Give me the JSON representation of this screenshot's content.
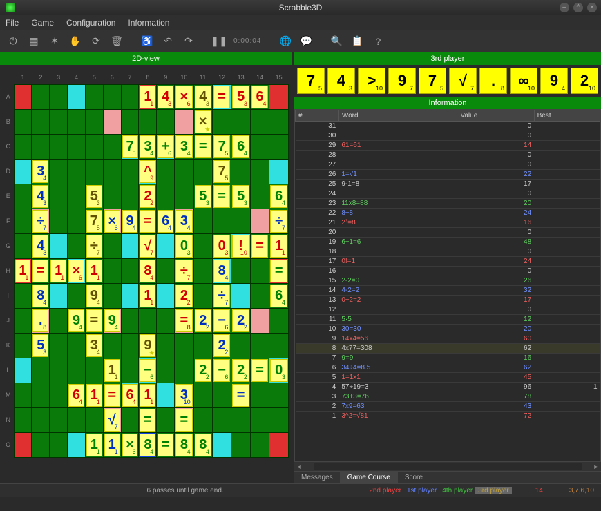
{
  "title": "Scrabble3D",
  "menu": [
    "File",
    "Game",
    "Configuration",
    "Information"
  ],
  "view_label": "2D-view",
  "player_label": "3rd player",
  "info_label": "Information",
  "cols": [
    "1",
    "2",
    "3",
    "4",
    "5",
    "6",
    "7",
    "8",
    "9",
    "10",
    "11",
    "12",
    "13",
    "14",
    "15"
  ],
  "rows": [
    "A",
    "B",
    "C",
    "D",
    "E",
    "F",
    "G",
    "H",
    "I",
    "J",
    "K",
    "L",
    "M",
    "N",
    "O"
  ],
  "counter": "0:00:04",
  "rack": [
    {
      "ch": "7",
      "sub": "5"
    },
    {
      "ch": "4",
      "sub": "3"
    },
    {
      "ch": ">",
      "sub": "10"
    },
    {
      "ch": "9",
      "sub": "7"
    },
    {
      "ch": "7",
      "sub": "5"
    },
    {
      "ch": "√",
      "sub": "7"
    },
    {
      "ch": ".",
      "sub": "8"
    },
    {
      "ch": "∞",
      "sub": "10"
    },
    {
      "ch": "9",
      "sub": "4"
    },
    {
      "ch": "2",
      "sub": "10"
    }
  ],
  "history_cols": [
    "#",
    "Word",
    "Value",
    "Best"
  ],
  "history": [
    {
      "n": "31",
      "w": "",
      "v": "0",
      "b": ""
    },
    {
      "n": "30",
      "w": "",
      "v": "0",
      "b": ""
    },
    {
      "n": "29",
      "w": "61=61",
      "v": "14",
      "b": "",
      "c": "red"
    },
    {
      "n": "28",
      "w": "",
      "v": "0",
      "b": ""
    },
    {
      "n": "27",
      "w": "",
      "v": "0",
      "b": ""
    },
    {
      "n": "26",
      "w": "1=√1",
      "v": "22",
      "b": "",
      "c": "blue"
    },
    {
      "n": "25",
      "w": "9-1=8",
      "v": "17",
      "b": ""
    },
    {
      "n": "24",
      "w": "",
      "v": "0",
      "b": ""
    },
    {
      "n": "23",
      "w": "11x8=88",
      "v": "20",
      "b": "",
      "c": "green"
    },
    {
      "n": "22",
      "w": "8÷8",
      "v": "24",
      "b": "",
      "c": "blue"
    },
    {
      "n": "21",
      "w": "2³=8",
      "v": "16",
      "b": "",
      "c": "red"
    },
    {
      "n": "20",
      "w": "",
      "v": "0",
      "b": ""
    },
    {
      "n": "19",
      "w": "6÷1=6",
      "v": "48",
      "b": "",
      "c": "green"
    },
    {
      "n": "18",
      "w": "",
      "v": "0",
      "b": ""
    },
    {
      "n": "17",
      "w": "0!=1",
      "v": "24",
      "b": "",
      "c": "red"
    },
    {
      "n": "16",
      "w": "",
      "v": "0",
      "b": ""
    },
    {
      "n": "15",
      "w": "2-2=0",
      "v": "26",
      "b": "",
      "c": "green"
    },
    {
      "n": "14",
      "w": "4-2=2",
      "v": "32",
      "b": "",
      "c": "blue"
    },
    {
      "n": "13",
      "w": "0÷2=2",
      "v": "17",
      "b": "",
      "c": "red"
    },
    {
      "n": "12",
      "w": "",
      "v": "0",
      "b": ""
    },
    {
      "n": "11",
      "w": "5·5",
      "v": "12",
      "b": "",
      "c": "green"
    },
    {
      "n": "10",
      "w": "30=30",
      "v": "20",
      "b": "",
      "c": "blue"
    },
    {
      "n": "9",
      "w": "14x4=56",
      "v": "60",
      "b": "",
      "c": "red"
    },
    {
      "n": "8",
      "w": "4x77=308",
      "v": "62",
      "b": "",
      "hl": true
    },
    {
      "n": "7",
      "w": "9=9",
      "v": "16",
      "b": "",
      "c": "green"
    },
    {
      "n": "6",
      "w": "34÷4=8.5",
      "v": "62",
      "b": "",
      "c": "blue"
    },
    {
      "n": "5",
      "w": "1=1x1",
      "v": "45",
      "b": "",
      "c": "red"
    },
    {
      "n": "4",
      "w": "57÷19=3",
      "v": "96",
      "b": "1"
    },
    {
      "n": "3",
      "w": "73+3=76",
      "v": "78",
      "b": "",
      "c": "green"
    },
    {
      "n": "2",
      "w": "7x9=63",
      "v": "43",
      "b": "",
      "c": "blue"
    },
    {
      "n": "1",
      "w": "3^2=√81",
      "v": "72",
      "b": "",
      "c": "red"
    }
  ],
  "tabs": [
    "Messages",
    "Game Course",
    "Score"
  ],
  "status_msg": "6 passes until game end.",
  "players": [
    "2nd player",
    "1st player",
    "4th player",
    "3rd player"
  ],
  "score1": "14",
  "score2": "3,7,6,10",
  "board": {
    "bg": [
      "r..c...r...c..r",
      ".g...p...p...g.",
      "..g...c.c...g..",
      "c..g...c...g..c",
      "....g.....g....",
      ".p...p...p...p.",
      "..c...c.c...c..",
      "r..c...g...c..r",
      "..c...c.c...c..",
      ".p...p...p...p.",
      "....g.....g....",
      "c..g...c...g..c",
      "..g...c.c...g..",
      ".g...p...p...g.",
      "r..c...b...c..r"
    ],
    "tiles": [
      {
        "r": 0,
        "c": 8,
        "ch": "1",
        "s": "1",
        "cl": "red"
      },
      {
        "r": 0,
        "c": 9,
        "ch": "4",
        "s": "3",
        "cl": "red"
      },
      {
        "r": 0,
        "c": 10,
        "ch": "×",
        "s": "6",
        "cl": "red"
      },
      {
        "r": 0,
        "c": 11,
        "ch": "4",
        "s": "3",
        "cl": "dark"
      },
      {
        "r": 0,
        "c": 12,
        "ch": "=",
        "s": "",
        "cl": "red"
      },
      {
        "r": 0,
        "c": 13,
        "ch": "5",
        "s": "3",
        "cl": "red"
      },
      {
        "r": 0,
        "c": 14,
        "ch": "6",
        "s": "4",
        "cl": "red"
      },
      {
        "r": 1,
        "c": 11,
        "ch": "×",
        "s": "",
        "cl": "dark",
        "star": true
      },
      {
        "r": 2,
        "c": 7,
        "ch": "7",
        "s": "5",
        "cl": "green"
      },
      {
        "r": 2,
        "c": 8,
        "ch": "3",
        "s": "4",
        "cl": "green"
      },
      {
        "r": 2,
        "c": 9,
        "ch": "+",
        "s": "6",
        "cl": "green"
      },
      {
        "r": 2,
        "c": 10,
        "ch": "3",
        "s": "4",
        "cl": "green"
      },
      {
        "r": 2,
        "c": 11,
        "ch": "=",
        "s": "",
        "cl": "green"
      },
      {
        "r": 2,
        "c": 12,
        "ch": "7",
        "s": "5",
        "cl": "green"
      },
      {
        "r": 2,
        "c": 13,
        "ch": "6",
        "s": "4",
        "cl": "green"
      },
      {
        "r": 3,
        "c": 2,
        "ch": "3",
        "s": "4",
        "cl": "blue"
      },
      {
        "r": 3,
        "c": 8,
        "ch": "^",
        "s": "9",
        "cl": "red"
      },
      {
        "r": 3,
        "c": 12,
        "ch": "7",
        "s": "5",
        "cl": "dark"
      },
      {
        "r": 4,
        "c": 2,
        "ch": "4",
        "s": "3",
        "cl": "blue"
      },
      {
        "r": 4,
        "c": 5,
        "ch": "5",
        "s": "3",
        "cl": "dark"
      },
      {
        "r": 4,
        "c": 8,
        "ch": "2",
        "s": "2",
        "cl": "red"
      },
      {
        "r": 4,
        "c": 11,
        "ch": "5",
        "s": "3",
        "cl": "green"
      },
      {
        "r": 4,
        "c": 12,
        "ch": "=",
        "s": "",
        "cl": "green"
      },
      {
        "r": 4,
        "c": 13,
        "ch": "5",
        "s": "3",
        "cl": "green"
      },
      {
        "r": 4,
        "c": 15,
        "ch": "6",
        "s": "4",
        "cl": "green"
      },
      {
        "r": 5,
        "c": 2,
        "ch": "÷",
        "s": "7",
        "cl": "blue"
      },
      {
        "r": 5,
        "c": 5,
        "ch": "7",
        "s": "5",
        "cl": "dark"
      },
      {
        "r": 5,
        "c": 6,
        "ch": "×",
        "s": "6",
        "cl": "blue"
      },
      {
        "r": 5,
        "c": 7,
        "ch": "9",
        "s": "4",
        "cl": "blue"
      },
      {
        "r": 5,
        "c": 8,
        "ch": "=",
        "s": "",
        "cl": "red"
      },
      {
        "r": 5,
        "c": 9,
        "ch": "6",
        "s": "4",
        "cl": "blue"
      },
      {
        "r": 5,
        "c": 10,
        "ch": "3",
        "s": "4",
        "cl": "blue"
      },
      {
        "r": 5,
        "c": 15,
        "ch": "÷",
        "s": "7",
        "cl": "blue"
      },
      {
        "r": 6,
        "c": 2,
        "ch": "4",
        "s": "3",
        "cl": "blue"
      },
      {
        "r": 6,
        "c": 5,
        "ch": "÷",
        "s": "7",
        "cl": "dark"
      },
      {
        "r": 6,
        "c": 8,
        "ch": "√",
        "s": "7",
        "cl": "red"
      },
      {
        "r": 6,
        "c": 10,
        "ch": "0",
        "s": "3",
        "cl": "green"
      },
      {
        "r": 6,
        "c": 12,
        "ch": "0",
        "s": "3",
        "cl": "red"
      },
      {
        "r": 6,
        "c": 13,
        "ch": "!",
        "s": "10",
        "cl": "red"
      },
      {
        "r": 6,
        "c": 14,
        "ch": "=",
        "s": "",
        "cl": "red"
      },
      {
        "r": 6,
        "c": 15,
        "ch": "1",
        "s": "1",
        "cl": "red"
      },
      {
        "r": 7,
        "c": 1,
        "ch": "1",
        "s": "1",
        "cl": "red"
      },
      {
        "r": 7,
        "c": 2,
        "ch": "=",
        "s": "",
        "cl": "red"
      },
      {
        "r": 7,
        "c": 3,
        "ch": "1",
        "s": "1",
        "cl": "red"
      },
      {
        "r": 7,
        "c": 4,
        "ch": "×",
        "s": "6",
        "cl": "red"
      },
      {
        "r": 7,
        "c": 5,
        "ch": "1",
        "s": "1",
        "cl": "red"
      },
      {
        "r": 7,
        "c": 8,
        "ch": "8",
        "s": "4",
        "cl": "red"
      },
      {
        "r": 7,
        "c": 10,
        "ch": "÷",
        "s": "7",
        "cl": "red"
      },
      {
        "r": 7,
        "c": 12,
        "ch": "8",
        "s": "4",
        "cl": "blue"
      },
      {
        "r": 7,
        "c": 15,
        "ch": "=",
        "s": "",
        "cl": "green"
      },
      {
        "r": 8,
        "c": 2,
        "ch": "8",
        "s": "4",
        "cl": "blue"
      },
      {
        "r": 8,
        "c": 5,
        "ch": "9",
        "s": "4",
        "cl": "dark"
      },
      {
        "r": 8,
        "c": 8,
        "ch": "1",
        "s": "1",
        "cl": "red"
      },
      {
        "r": 8,
        "c": 10,
        "ch": "2",
        "s": "2",
        "cl": "red"
      },
      {
        "r": 8,
        "c": 12,
        "ch": "÷",
        "s": "7",
        "cl": "blue"
      },
      {
        "r": 8,
        "c": 15,
        "ch": "6",
        "s": "4",
        "cl": "green"
      },
      {
        "r": 9,
        "c": 2,
        "ch": ".",
        "s": "8",
        "cl": "blue"
      },
      {
        "r": 9,
        "c": 4,
        "ch": "9",
        "s": "4",
        "cl": "green"
      },
      {
        "r": 9,
        "c": 5,
        "ch": "=",
        "s": "",
        "cl": "dark"
      },
      {
        "r": 9,
        "c": 6,
        "ch": "9",
        "s": "4",
        "cl": "green"
      },
      {
        "r": 9,
        "c": 10,
        "ch": "=",
        "s": "8",
        "cl": "red"
      },
      {
        "r": 9,
        "c": 11,
        "ch": "2",
        "s": "2",
        "cl": "blue"
      },
      {
        "r": 9,
        "c": 12,
        "ch": "−",
        "s": "6",
        "cl": "blue"
      },
      {
        "r": 9,
        "c": 13,
        "ch": "2",
        "s": "2",
        "cl": "blue"
      },
      {
        "r": 10,
        "c": 2,
        "ch": "5",
        "s": "3",
        "cl": "blue"
      },
      {
        "r": 10,
        "c": 5,
        "ch": "3",
        "s": "4",
        "cl": "dark"
      },
      {
        "r": 10,
        "c": 8,
        "ch": "9",
        "s": "",
        "cl": "dark",
        "star": true
      },
      {
        "r": 10,
        "c": 12,
        "ch": "2",
        "s": "2",
        "cl": "blue"
      },
      {
        "r": 11,
        "c": 6,
        "ch": "1",
        "s": "1",
        "cl": "dark"
      },
      {
        "r": 11,
        "c": 8,
        "ch": "−",
        "s": "6",
        "cl": "green"
      },
      {
        "r": 11,
        "c": 11,
        "ch": "2",
        "s": "2",
        "cl": "green"
      },
      {
        "r": 11,
        "c": 12,
        "ch": "−",
        "s": "6",
        "cl": "green"
      },
      {
        "r": 11,
        "c": 13,
        "ch": "2",
        "s": "2",
        "cl": "green"
      },
      {
        "r": 11,
        "c": 14,
        "ch": "=",
        "s": "",
        "cl": "green"
      },
      {
        "r": 11,
        "c": 15,
        "ch": "0",
        "s": "3",
        "cl": "green"
      },
      {
        "r": 12,
        "c": 4,
        "ch": "6",
        "s": "4",
        "cl": "red"
      },
      {
        "r": 12,
        "c": 5,
        "ch": "1",
        "s": "1",
        "cl": "red"
      },
      {
        "r": 12,
        "c": 6,
        "ch": "=",
        "s": "",
        "cl": "red"
      },
      {
        "r": 12,
        "c": 7,
        "ch": "6",
        "s": "4",
        "cl": "red"
      },
      {
        "r": 12,
        "c": 8,
        "ch": "1",
        "s": "1",
        "cl": "red"
      },
      {
        "r": 12,
        "c": 10,
        "ch": "3",
        "s": "10",
        "cl": "blue"
      },
      {
        "r": 12,
        "c": 13,
        "ch": "=",
        "s": "",
        "cl": "blue"
      },
      {
        "r": 13,
        "c": 6,
        "ch": "√",
        "s": "7",
        "cl": "blue"
      },
      {
        "r": 13,
        "c": 8,
        "ch": "=",
        "s": "",
        "cl": "green"
      },
      {
        "r": 13,
        "c": 10,
        "ch": "=",
        "s": "",
        "cl": "green"
      },
      {
        "r": 14,
        "c": 5,
        "ch": "1",
        "s": "1",
        "cl": "green"
      },
      {
        "r": 14,
        "c": 6,
        "ch": "1",
        "s": "1",
        "cl": "blue"
      },
      {
        "r": 14,
        "c": 7,
        "ch": "×",
        "s": "6",
        "cl": "green"
      },
      {
        "r": 14,
        "c": 8,
        "ch": "8",
        "s": "4",
        "cl": "green"
      },
      {
        "r": 14,
        "c": 9,
        "ch": "=",
        "s": "",
        "cl": "green"
      },
      {
        "r": 14,
        "c": 10,
        "ch": "8",
        "s": "4",
        "cl": "green"
      },
      {
        "r": 14,
        "c": 11,
        "ch": "8",
        "s": "4",
        "cl": "green"
      }
    ]
  }
}
